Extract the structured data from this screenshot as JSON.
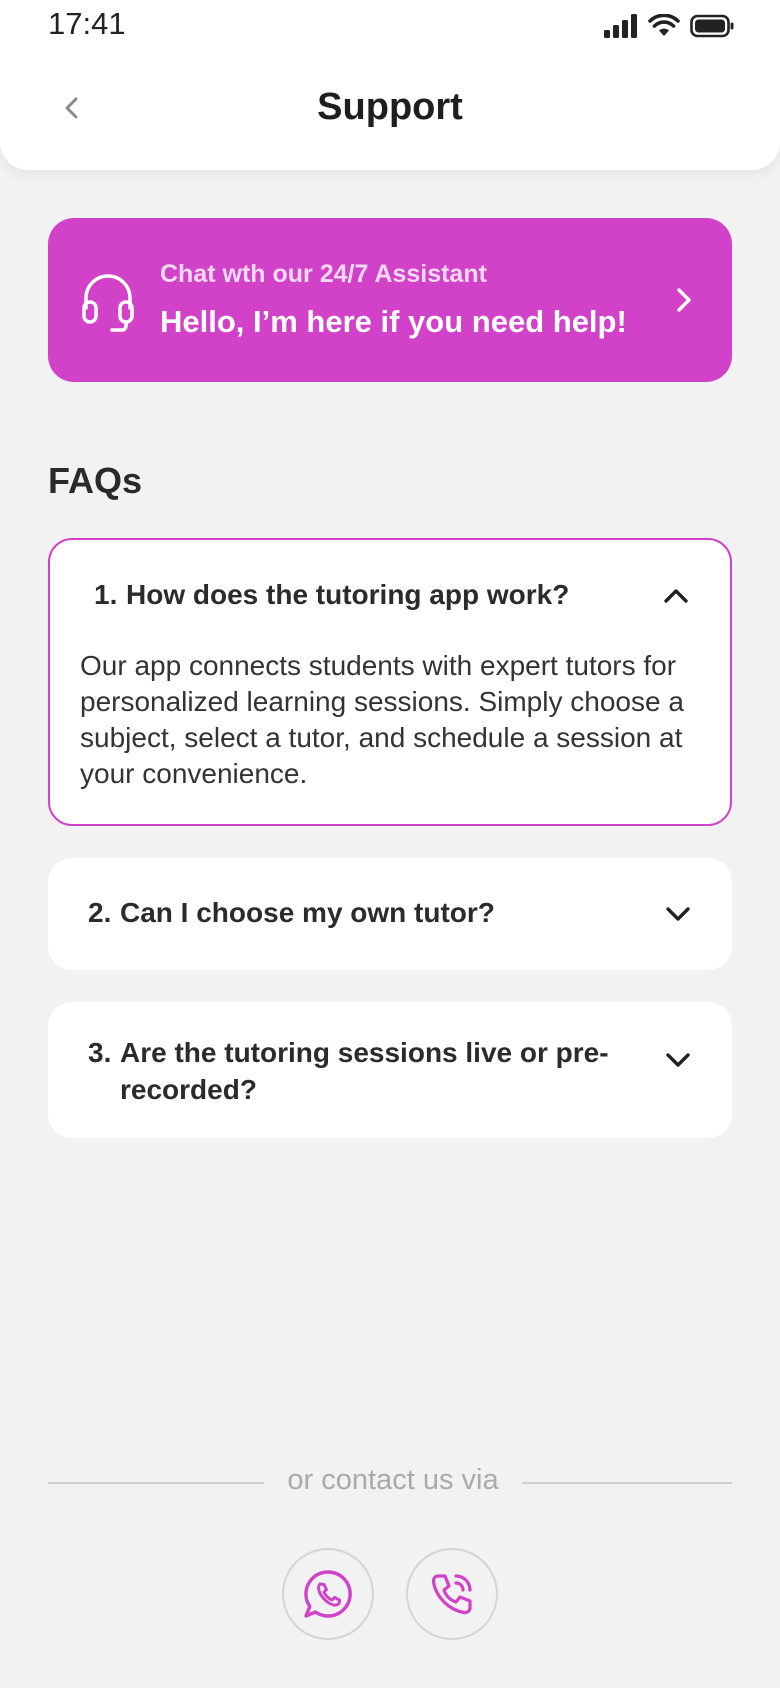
{
  "status_bar": {
    "time": "17:41"
  },
  "header": {
    "title": "Support"
  },
  "assistant": {
    "subtitle": "Chat wth our 24/7 Assistant",
    "title": "Hello, I’m here if you need help!"
  },
  "faqs": {
    "heading": "FAQs",
    "items": [
      {
        "number": "1.",
        "question": "How does the tutoring app work?",
        "answer": "Our app connects students with expert tutors for personalized learning sessions. Simply choose a subject, select a tutor, and schedule a session at your convenience.",
        "expanded": true
      },
      {
        "number": "2.",
        "question": "Can I choose my own tutor?",
        "expanded": false
      },
      {
        "number": "3.",
        "question": "Are the tutoring sessions live or pre-recorded?",
        "expanded": false
      }
    ]
  },
  "contact": {
    "label": "or contact us via",
    "options": [
      {
        "icon": "whatsapp-icon"
      },
      {
        "icon": "phone-call-icon"
      }
    ]
  },
  "colors": {
    "accent": "#d142c9",
    "background": "#f2f2f2",
    "card": "#ffffff",
    "text": "#222222"
  }
}
